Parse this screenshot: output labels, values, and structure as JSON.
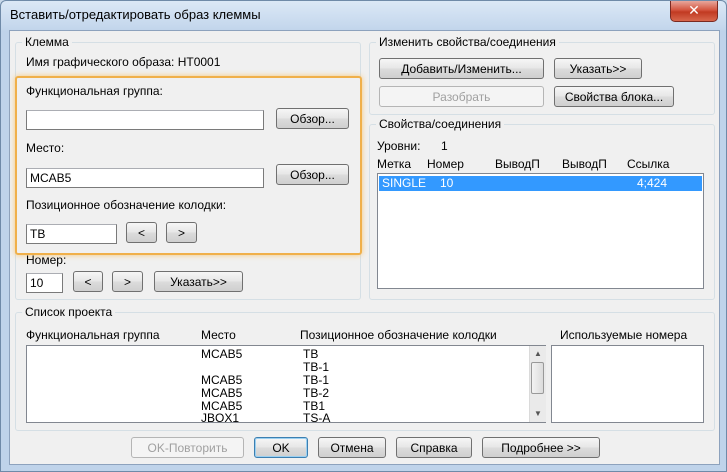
{
  "window": {
    "title": "Вставить/отредактировать образ клеммы",
    "close_symbol": "✕"
  },
  "terminal": {
    "group_label": "Клемма",
    "graphic_name_label": "Имя графического образа: HT0001",
    "functional_group_label": "Функциональная группа:",
    "functional_group_value": "",
    "browse_label": "Обзор...",
    "location_label": "Место:",
    "location_value": "MCAB5",
    "browse2_label": "Обзор...",
    "strip_label": "Позиционное обозначение колодки:",
    "strip_value": "TB",
    "prev_label": "<",
    "next_label": ">",
    "number_label": "Номер:",
    "number_value": "10",
    "num_prev_label": "<",
    "num_next_label": ">",
    "pick_label": "Указать>>"
  },
  "modify": {
    "group_label": "Изменить свойства/соединения",
    "add_modify_label": "Добавить/Изменить...",
    "pick_label": "Указать>>",
    "disassemble_label": "Разобрать",
    "block_props_label": "Свойства блока..."
  },
  "props": {
    "group_label": "Свойства/соединения",
    "levels_label": "Уровни:",
    "levels_value": "1",
    "columns": [
      "Метка",
      "Номер",
      "ВыводП",
      "ВыводП",
      "Ссылка"
    ],
    "row": {
      "label": "SINGLE",
      "number": "10",
      "ref": "4;424"
    }
  },
  "project": {
    "group_label": "Список проекта",
    "columns": [
      "Функциональная группа",
      "Место",
      "Позиционное обозначение колодки",
      "Используемые номера"
    ],
    "rows": [
      {
        "loc": "MCAB5",
        "strip": "TB"
      },
      {
        "loc": "",
        "strip": "TB-1"
      },
      {
        "loc": "MCAB5",
        "strip": "TB-1"
      },
      {
        "loc": "MCAB5",
        "strip": "TB-2"
      },
      {
        "loc": "MCAB5",
        "strip": "TB1"
      },
      {
        "loc": "JBOX1",
        "strip": "TS-A"
      }
    ]
  },
  "footer": {
    "ok_repeat_label": "OK-Повторить",
    "ok_label": "OK",
    "cancel_label": "Отмена",
    "help_label": "Справка",
    "details_label": "Подробнее >>"
  }
}
